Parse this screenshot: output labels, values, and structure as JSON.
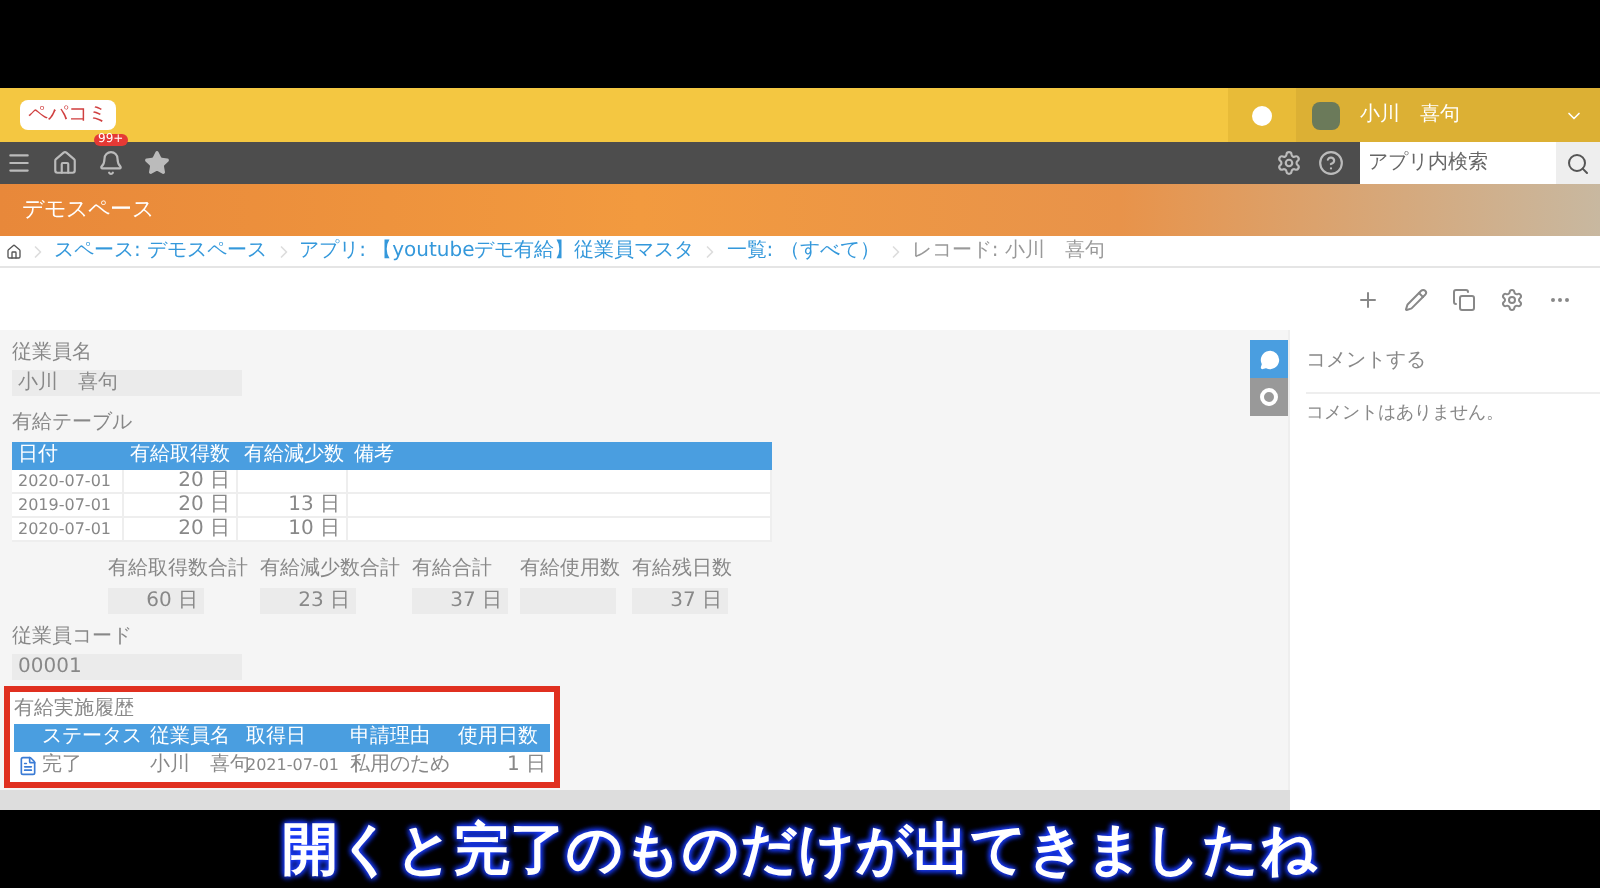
{
  "header": {
    "logo": "ペパコミ",
    "user": "小川　喜句"
  },
  "nav": {
    "badge": "99+",
    "search": {
      "placeholder": "アプリ内検索"
    }
  },
  "banner": {
    "title": "デモスペース"
  },
  "breadcrumbs": [
    "スペース: デモスペース",
    "アプリ: 【youtubeデモ有給】従業員マスタ",
    "一覧: （すべて）",
    "レコード: 小川　喜句"
  ],
  "form": {
    "name_label": "従業員名",
    "name_value": "小川　喜句",
    "table_label": "有給テーブル",
    "table": {
      "columns": [
        "日付",
        "有給取得数",
        "有給減少数",
        "備考"
      ],
      "rows": [
        [
          "2020-07-01",
          "20 日",
          "",
          ""
        ],
        [
          "2019-07-01",
          "20 日",
          "13 日",
          ""
        ],
        [
          "2020-07-01",
          "20 日",
          "10 日",
          ""
        ]
      ]
    },
    "totals": [
      {
        "label": "有給取得数合計",
        "value": "60 日"
      },
      {
        "label": "有給減少数合計",
        "value": "23 日"
      },
      {
        "label": "有給合計",
        "value": "37 日"
      },
      {
        "label": "有給使用数"
      },
      {
        "label": "有給残日数",
        "value": "37 日"
      }
    ],
    "code_label": "従業員コード",
    "code_value": "00001",
    "history": {
      "label": "有給実施履歴",
      "columns": [
        "ステータス",
        "従業員名",
        "取得日",
        "申請理由",
        "使用日数"
      ],
      "rows": [
        [
          "完了",
          "小川　喜句",
          "2021-07-01",
          "私用のため",
          "1 日"
        ]
      ]
    }
  },
  "comments": {
    "placeholder": "コメントする",
    "empty": "コメントはありません。"
  },
  "subtitle": "開くと完了のものだけが出てきましたね"
}
